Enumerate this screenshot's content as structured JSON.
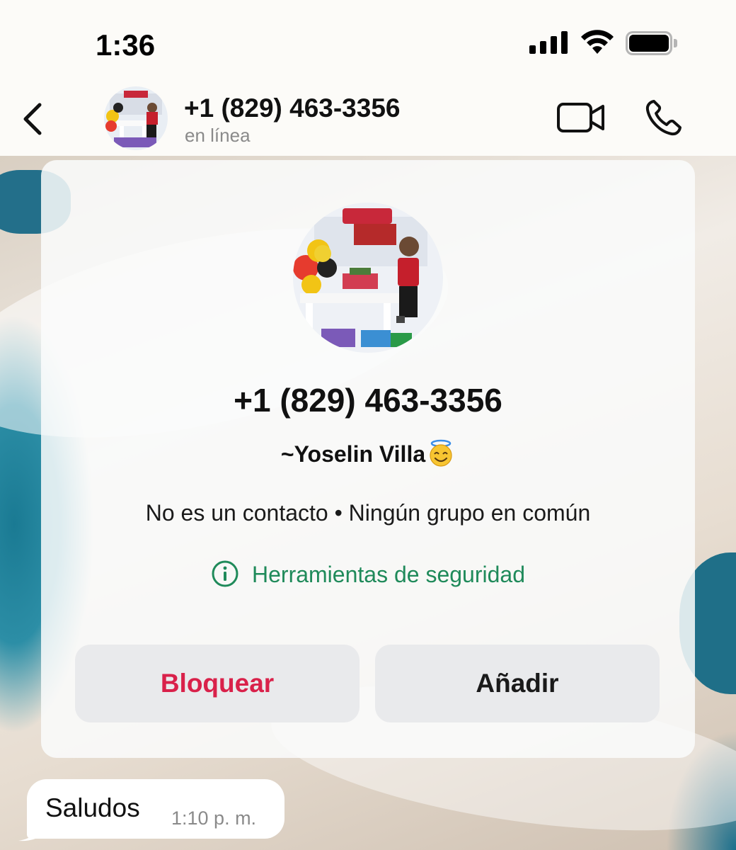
{
  "status_bar": {
    "time": "1:36"
  },
  "header": {
    "title": "+1 (829) 463-3356",
    "status": "en línea",
    "icons": [
      "back-chevron-icon",
      "video-camera-icon",
      "phone-icon"
    ]
  },
  "contact_card": {
    "phone": "+1 (829) 463-3356",
    "name": "~Yoselin Villa",
    "name_emoji": "smiling-face-with-halo",
    "info": "No es un contacto • Ningún grupo en común",
    "safety_link": "Herramientas de seguridad",
    "block_label": "Bloquear",
    "add_label": "Añadir"
  },
  "messages": [
    {
      "text": "Saludos",
      "time": "1:10 p. m."
    }
  ],
  "colors": {
    "danger": "#d9214a",
    "link_green": "#1f8a5a"
  }
}
